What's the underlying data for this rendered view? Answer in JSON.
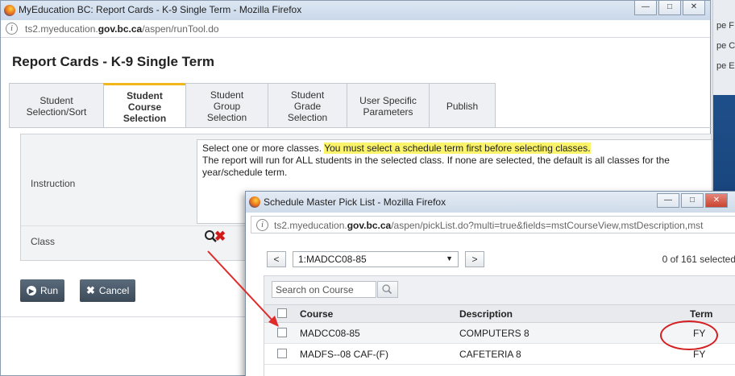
{
  "main_window": {
    "title": "MyEducation BC: Report Cards - K-9 Single Term - Mozilla Firefox",
    "url_prefix": "ts2.myeducation.",
    "url_domain": "gov.bc.ca",
    "url_path": "/aspen/runTool.do",
    "page_title": "Report Cards - K-9 Single Term",
    "tabs": [
      {
        "label": "Student Selection/Sort",
        "active": false
      },
      {
        "label": "Student Course Selection",
        "active": true
      },
      {
        "label": "Student Group Selection",
        "active": false
      },
      {
        "label": "Student Grade Selection",
        "active": false
      },
      {
        "label": "User Specific Parameters",
        "active": false
      },
      {
        "label": "Publish",
        "active": false
      }
    ],
    "instruction_label": "Instruction",
    "instruction_plain": "Select one or more classes. ",
    "instruction_highlight": "You must select a schedule term first before selecting classes.",
    "instruction_rest": "The report will run for ALL students in the selected class. If none are selected, the default is all classes for the year/schedule term.",
    "class_label": "Class",
    "run_label": "Run",
    "cancel_label": "Cancel"
  },
  "background_window": {
    "fragments": [
      "pe F",
      "pe C",
      "pe E"
    ]
  },
  "popup": {
    "title": "Schedule Master Pick List - Mozilla Firefox",
    "url_prefix": "ts2.myeducation.",
    "url_domain": "gov.bc.ca",
    "url_path": "/aspen/pickList.do?multi=true&fields=mstCourseView,mstDescription,mst",
    "prev_label": "<",
    "next_label": ">",
    "selected_term": "1:MADCC08-85",
    "selection_count": "0 of 161 selected",
    "search_placeholder": "Search on Course",
    "columns": [
      "Course",
      "Description",
      "Term"
    ],
    "rows": [
      {
        "course": "MADCC08-85",
        "description": "COMPUTERS 8",
        "term": "FY"
      },
      {
        "course": "MADFS--08 CAF-(F)",
        "description": "CAFETERIA 8",
        "term": "FY"
      }
    ]
  }
}
